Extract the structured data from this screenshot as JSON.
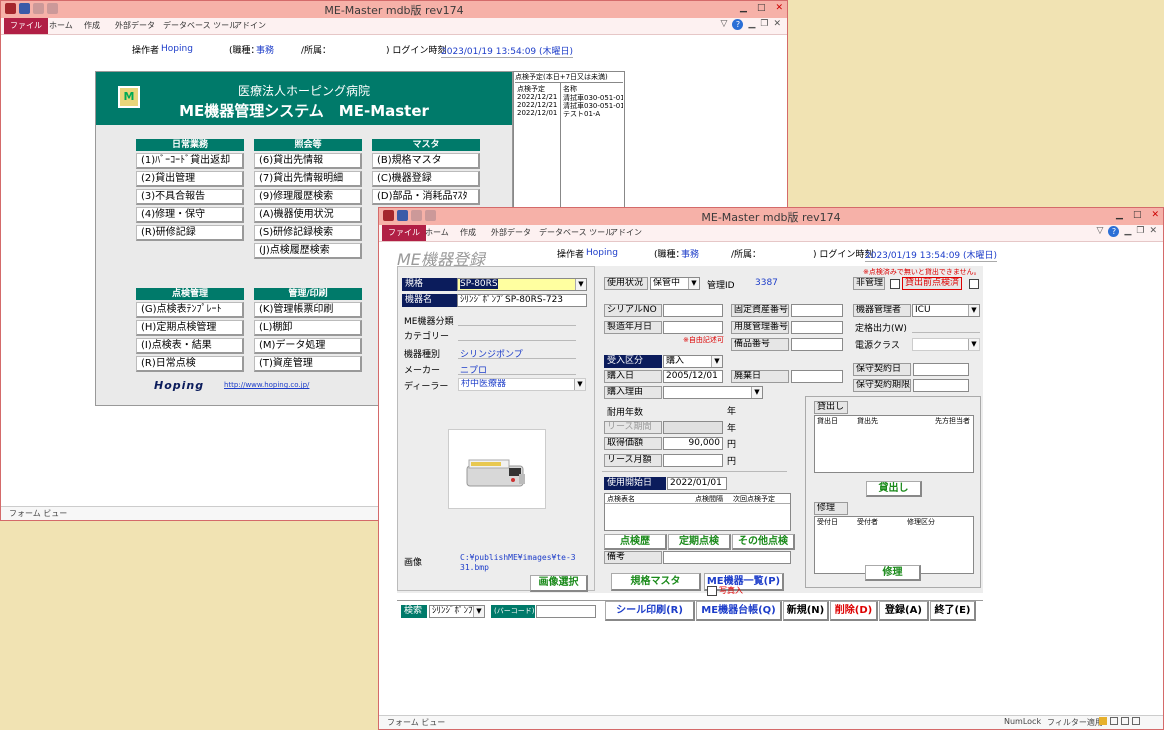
{
  "window1": {
    "title": "ME-Master mdb版 rev174",
    "ribbon_tabs": [
      "ファイル",
      "ホーム",
      "作成",
      "外部データ",
      "データベース ツール",
      "アドイン"
    ],
    "header": {
      "operator_label": "操作者",
      "operator": "Hoping",
      "job_label": "(職種：",
      "job": "事務",
      "dept_label": "/所属：",
      "login_label": ") ログイン時刻",
      "login_time": "2023/01/19 13:54:09 (木曜日)"
    },
    "banner": {
      "hospital": "医療法人ホーピング病院",
      "system": "ME機器管理システム　ME-Master"
    },
    "schedule": {
      "title": "点検予定(本日+7日又は未満)",
      "col_date": "点検予定",
      "col_name": "名称",
      "rows": [
        {
          "date": "2022/12/21",
          "name": "清拭車030-051-01-"
        },
        {
          "date": "2022/12/21",
          "name": "清拭車030-051-01-"
        },
        {
          "date": "2022/12/01",
          "name": "テスト01-A"
        }
      ]
    },
    "sections": {
      "daily": {
        "title": "日常業務",
        "items": [
          "(1)ﾊﾞｰｺｰﾄﾞ貸出返却",
          "(2)貸出管理",
          "(3)不具合報告",
          "(4)修理・保守",
          "(R)研修記録"
        ]
      },
      "inquiry": {
        "title": "照会等",
        "items": [
          "(6)貸出先情報",
          "(7)貸出先情報明細",
          "(9)修理履歴検索",
          "(A)機器使用状況",
          "(S)研修記録検索",
          "(J)点検履歴検索"
        ]
      },
      "master": {
        "title": "マスタ",
        "items": [
          "(B)規格マスタ",
          "(C)機器登録",
          "(D)部品・消耗品ﾏｽﾀ"
        ]
      },
      "inspection": {
        "title": "点検管理",
        "items": [
          "(G)点検表ﾃﾝﾌﾟﾚｰﾄ",
          "(H)定期点検管理",
          "(I)点検表・結果",
          "(R)日常点検"
        ]
      },
      "admin": {
        "title": "管理/印刷",
        "items": [
          "(K)管理帳票印刷",
          "(L)棚卸",
          "(M)データ処理",
          "(T)資産管理"
        ]
      }
    },
    "footer_logo": "Hoping",
    "footer_url": "http://www.hoping.co.jp/",
    "status": "フォーム ビュー"
  },
  "window2": {
    "title": "ME-Master mdb版 rev174",
    "ribbon_tabs": [
      "ファイル",
      "ホーム",
      "作成",
      "外部データ",
      "データベース ツール",
      "アドイン"
    ],
    "form_title": "ME機器登録",
    "header": {
      "operator_label": "操作者",
      "operator": "Hoping",
      "job_label": "(職種：",
      "job": "事務",
      "dept_label": "/所属：",
      "login_label": ") ログイン時刻",
      "login_time": "2023/01/19 13:54:09 (木曜日)"
    },
    "left": {
      "spec_label": "規格",
      "spec_value": "SP-80RS",
      "name_label": "機器名",
      "name_value": "ｼﾘﾝｼﾞﾎﾟﾝﾌﾟSP-80RS-723",
      "class_label": "ME機器分類",
      "category_label": "カテゴリー",
      "type_label": "機器種別",
      "type_value": "シリンジポンプ",
      "maker_label": "メーカー",
      "maker_value": "ニプロ",
      "dealer_label": "ディーラー",
      "dealer_value": "村中医療器",
      "image_label": "画像",
      "image_path": "C:¥publishME¥images¥te-331.bmp",
      "image_select": "画像選択"
    },
    "middle": {
      "usage_label": "使用状況",
      "usage_value": "保管中",
      "mgmt_id_label": "管理ID",
      "mgmt_id": "3387",
      "serial_label": "シリアルNO",
      "mfg_label": "製造年月日",
      "free_note": "※自由記述可",
      "asset_no_label": "固定資産番号",
      "supply_no_label": "用度管理番号",
      "parts_no_label": "備品番号",
      "receipt_label": "受入区分",
      "receipt_value": "購入",
      "purchase_date_label": "購入日",
      "purchase_date": "2005/12/01",
      "disposal_label": "廃棄日",
      "reason_label": "購入理由",
      "life_label": "耐用年数",
      "year1": "年",
      "lease_label": "リース期間",
      "year2": "年",
      "price_label": "取得価額",
      "price": "90,000",
      "yen1": "円",
      "lease_monthly_label": "リース月額",
      "yen2": "円",
      "start_label": "使用開始日",
      "start_date": "2022/01/01",
      "insp_col1": "点検表名",
      "insp_col2": "点検間隔",
      "insp_col3": "次回点検予定",
      "btn_history": "点検歴",
      "btn_periodic": "定期点検",
      "btn_other": "その他点検",
      "remarks_label": "備考",
      "btn_spec_master": "規格マスタ",
      "btn_list": "ME機器一覧(P)",
      "photo_label": "写真入"
    },
    "right": {
      "unmanaged_label": "非管理",
      "note": "※点検済みで無いと貸出できません。",
      "pre_check": "貸出前点検済",
      "admin_label": "機器管理者",
      "admin_value": "ICU",
      "output_label": "定格出力(W)",
      "power_label": "電源クラス",
      "maint_date_label": "保守契約日",
      "maint_limit_label": "保守契約期限",
      "loan_title": "貸出し",
      "loan_col1": "貸出日",
      "loan_col2": "貸出先",
      "loan_col3": "先方担当者",
      "loan_btn": "貸出し",
      "repair_title": "修理",
      "repair_col1": "受付日",
      "repair_col2": "受付者",
      "repair_col3": "修理区分",
      "repair_btn": "修理"
    },
    "bottom": {
      "search_label": "検索",
      "search_value": "ｼﾘﾝｼﾞﾎﾟﾝﾌﾟ",
      "barcode_label": "(バーコード)",
      "btn_seal": "シール印刷(R)",
      "btn_ledger": "ME機器台帳(Q)",
      "btn_new": "新規(N)",
      "btn_delete": "削除(D)",
      "btn_register": "登録(A)",
      "btn_exit": "終了(E)"
    },
    "status": "フォーム ビュー",
    "status_right1": "NumLock",
    "status_right2": "フィルター適用"
  }
}
